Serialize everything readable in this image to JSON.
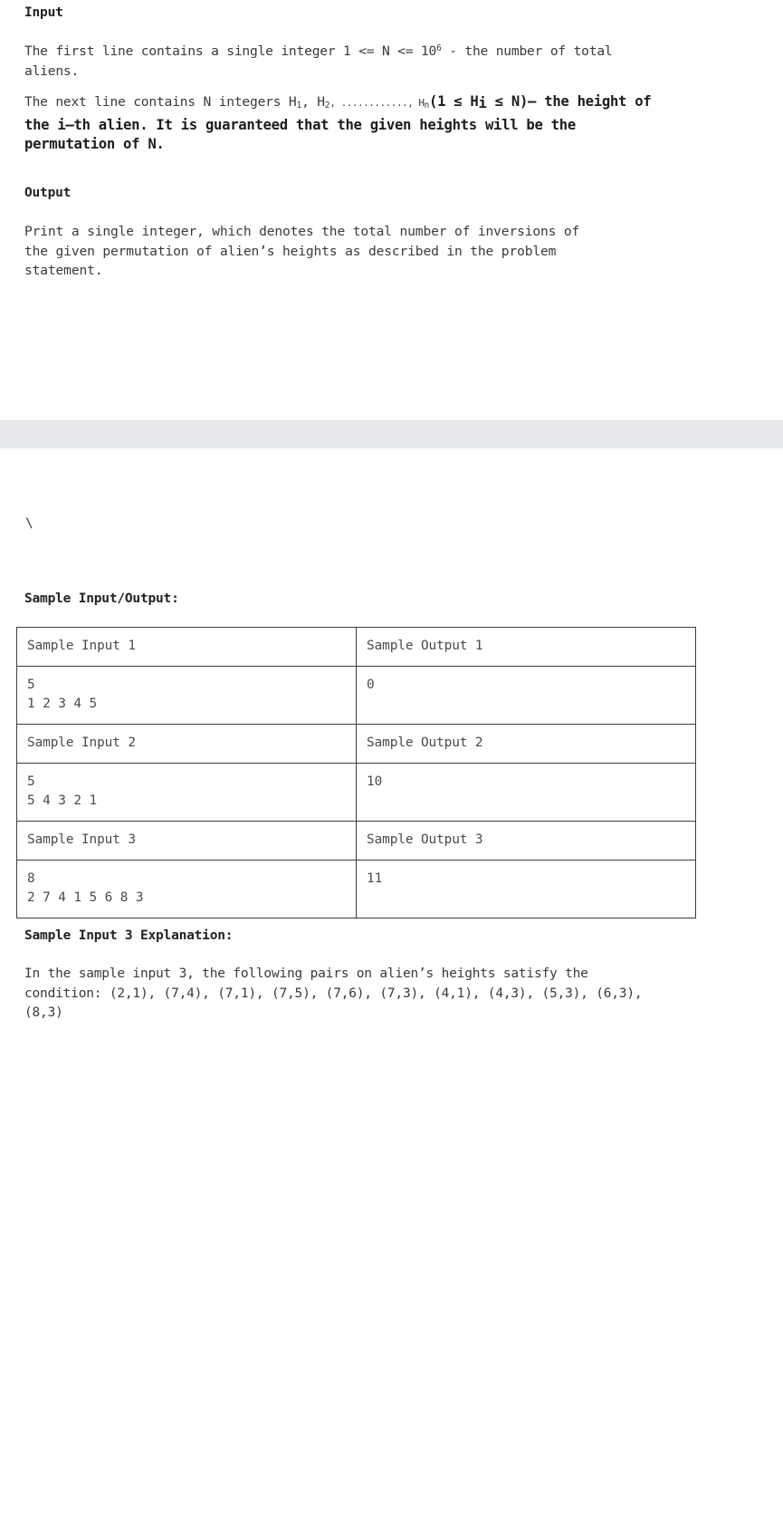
{
  "document": {
    "sections": {
      "input": {
        "heading": "Input",
        "para1": "The first line contains a single integer 1 <= N <= 10",
        "para1_sup": "6",
        "para1_cont": " - the number of total aliens.",
        "para2_plain_a": "The next line contains N integers H",
        "para2_sub1": "1",
        "para2_plain_b": ", H",
        "para2_sub2": "2",
        "para2_plain_c": ", ............, H",
        "para2_sub3": "n",
        "para2_bold": "(1 ≤ H",
        "para2_bold_sub": "i",
        "para2_bold_cont": " ≤ N)– the height of the i–th alien. It is guaranteed that the given heights will be the permutation of N."
      },
      "output": {
        "heading": "Output",
        "para": "Print a single integer, which denotes the total number of inversions of the given permutation of alien’s heights as described in the problem statement."
      },
      "stray_text": "\\",
      "samples": {
        "heading": "Sample Input/Output:",
        "rows": [
          {
            "label_input": "Sample Input 1",
            "label_output": "Sample Output 1",
            "data_input": "5\n1 2 3 4 5",
            "data_output": "0"
          },
          {
            "label_input": "Sample Input 2",
            "label_output": "Sample Output 2",
            "data_input": "5\n5 4 3 2 1",
            "data_output": "10"
          },
          {
            "label_input": "Sample Input 3",
            "label_output": "Sample Output 3",
            "data_input": "8\n2 7 4 1 5 6 8 3",
            "data_output": "11"
          }
        ]
      },
      "explanation": {
        "heading": "Sample Input 3 Explanation:",
        "para": "In the sample input 3, the following pairs on alien’s heights satisfy the condition: (2,1), (7,4), (7,1), (7,5), (7,6), (7,3), (4,1), (4,3), (5,3), (6,3), (8,3)"
      }
    }
  },
  "colors": {
    "page_background": "#ffffff",
    "body_text": "#3a3a3a",
    "heading_text": "#222222",
    "table_border": "#3d3d3d",
    "grey_band": "#e7e9ed"
  }
}
